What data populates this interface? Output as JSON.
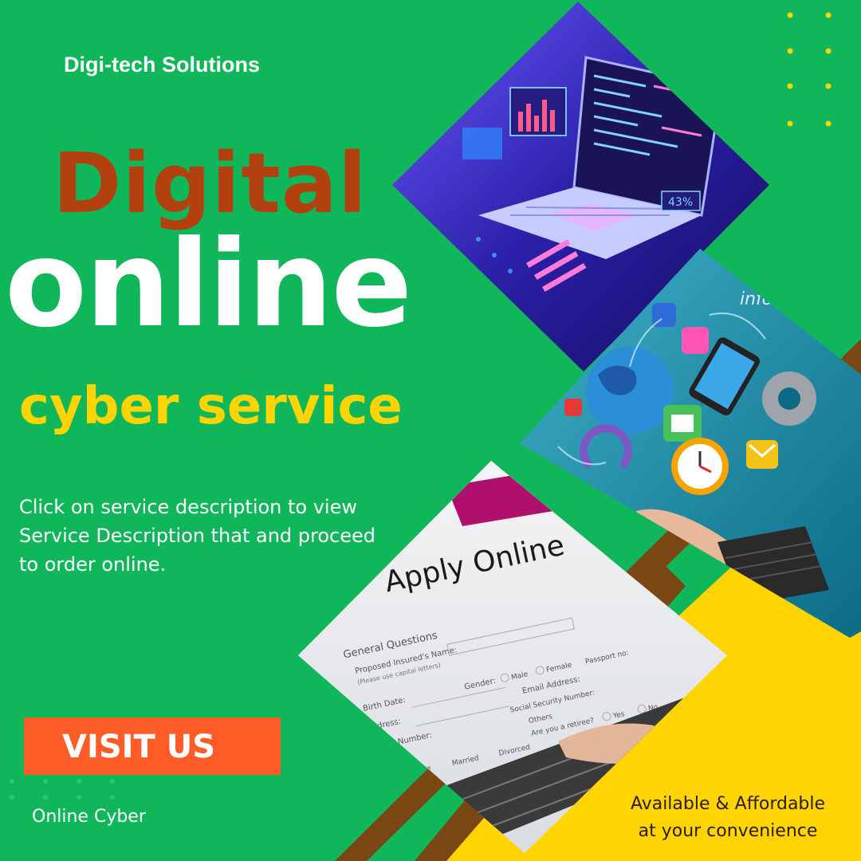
{
  "brand": "Digi-tech Solutions",
  "headline": {
    "line1": "Digital",
    "line2": "online",
    "line3": "cyber service"
  },
  "description": "Click on service description to view Service Description that and proceed to  order online.",
  "cta": {
    "label": "VISIT US"
  },
  "footer_left": "Online Cyber",
  "tagline": {
    "line1": "Available & Affordable",
    "line2": "at your convenience"
  },
  "panels": {
    "laptop_code": {
      "overlay_text": "43%"
    },
    "apply_form": {
      "title": "Apply Online",
      "section": "General Questions",
      "fields": [
        "Proposed Insured's Name:",
        "(Please use capital letters)",
        "Birth Date:",
        "Gender:",
        "Male",
        "Female",
        "Passport no:",
        "Email Address:",
        "Address:",
        "Social Security Number:",
        "Phone Number:",
        "Others",
        "Are you a retiree?",
        "Yes",
        "No",
        "Single",
        "Married",
        "Divorced"
      ]
    },
    "network_icons": {
      "overlay_text": "infor"
    }
  },
  "colors": {
    "background": "#10b65a",
    "accent_yellow": "#ffd400",
    "accent_brown": "#7a4714",
    "accent_orange": "#fd5c26",
    "headline_brown": "#b2410f"
  }
}
